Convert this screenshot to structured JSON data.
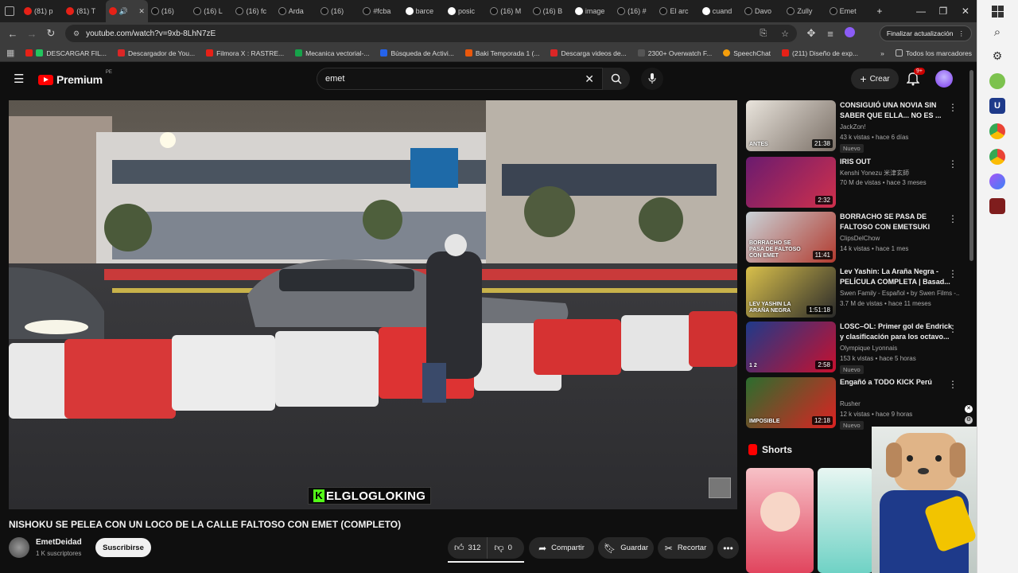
{
  "browser": {
    "tabs": [
      "(81) p",
      "(81) T",
      "",
      "(16) ",
      "(16) L",
      "(16) fc",
      "Arda",
      "(16) ",
      "#fcba",
      "barce",
      "posic",
      "(16) M",
      "(16) B",
      "image",
      "(16) #",
      "El arc",
      "cuand",
      "Davo",
      "Zully",
      "Emet"
    ],
    "new_tab": "+",
    "window_controls": [
      "—",
      "❐",
      "✕"
    ],
    "url": "youtube.com/watch?v=9xb-8LhN7zE",
    "update_button": "Finalizar actualización",
    "bookmarks": [
      "DESCARGAR FIL...",
      "Descargador de You...",
      "Filmora X : RASTRE...",
      "Mecanica vectorial-...",
      "Búsqueda de Activi...",
      "Baki Temporada 1 (...",
      "Descarga videos de...",
      "2300+ Overwatch F...",
      "SpeechChat",
      "(211) Diseño de exp..."
    ],
    "bookmarks_overflow": "»",
    "all_bookmarks": "Todos los marcadores"
  },
  "youtube": {
    "logo": "Premium",
    "logo_region": "PE",
    "search_value": "emet",
    "create_label": "Crear",
    "notifications_badge": "9+",
    "video": {
      "title": "NISHOKU SE PELEA CON UN LOCO DE LA CALLE FALTOSO CON EMET (COMPLETO)",
      "overlay_text": "ELGLOGLOKING",
      "channel": "EmetDeidad",
      "subscribers": "1 K suscriptores",
      "subscribe_label": "Suscribirse",
      "likes": "312",
      "dislikes": "0",
      "share_label": "Compartir",
      "save_label": "Guardar",
      "clip_label": "Recortar"
    },
    "recommended": [
      {
        "title": "CONSIGUIÓ UNA NOVIA SIN SABER QUE ELLA... NO ES ...",
        "channel": "JackZon!",
        "meta": "43 k vistas • hace 6 días",
        "badge": "Nuevo",
        "duration": "21:38",
        "thumb_text": "ANTES",
        "thumb_colors": [
          "#e9e4dc",
          "#7a6f66"
        ]
      },
      {
        "title": "IRIS OUT",
        "channel": "Kenshi Yonezu 米津玄師",
        "meta": "70 M de vistas • hace 3 meses",
        "badge": "",
        "duration": "2:32",
        "thumb_text": "",
        "thumb_colors": [
          "#6a1b6f",
          "#d0304c"
        ]
      },
      {
        "title": "BORRACHO SE PASA DE FALTOSO CON EMETSUKI",
        "channel": "ClipsDelChow",
        "meta": "14 k vistas • hace 1 mes",
        "badge": "",
        "duration": "11:41",
        "thumb_text": "BORRACHO SE PASA DE FALTOSO CON EMET",
        "thumb_colors": [
          "#c9d3d8",
          "#b23a2e"
        ]
      },
      {
        "title": "Lev Yashin: La Araña Negra - PELÍCULA COMPLETA | Basad...",
        "channel": "Swen Family - Español • by Swen Films -...",
        "meta": "3.7 M de vistas • hace 11 meses",
        "badge": "",
        "duration": "1:51:18",
        "thumb_text": "LEV YASHIN LA ARAÑA NEGRA",
        "thumb_colors": [
          "#d9c04b",
          "#2a2a2a"
        ]
      },
      {
        "title": "LOSC–OL: Primer gol de Endrick y clasificación para los octavo...",
        "channel": "Olympique Lyonnais",
        "meta": "153 k vistas • hace 5 horas",
        "badge": "Nuevo",
        "duration": "2:58",
        "thumb_text": "1 2",
        "thumb_colors": [
          "#1e3a8a",
          "#c8102e"
        ]
      },
      {
        "title": "Engañó a TODO KICK Perú",
        "channel": "Rusher",
        "meta": "12 k vistas • hace 9 horas",
        "badge": "Nuevo",
        "duration": "12:18",
        "thumb_text": "IMPOSIBLE",
        "thumb_colors": [
          "#2b6e2e",
          "#d22"
        ]
      }
    ],
    "shorts_label": "Shorts"
  }
}
